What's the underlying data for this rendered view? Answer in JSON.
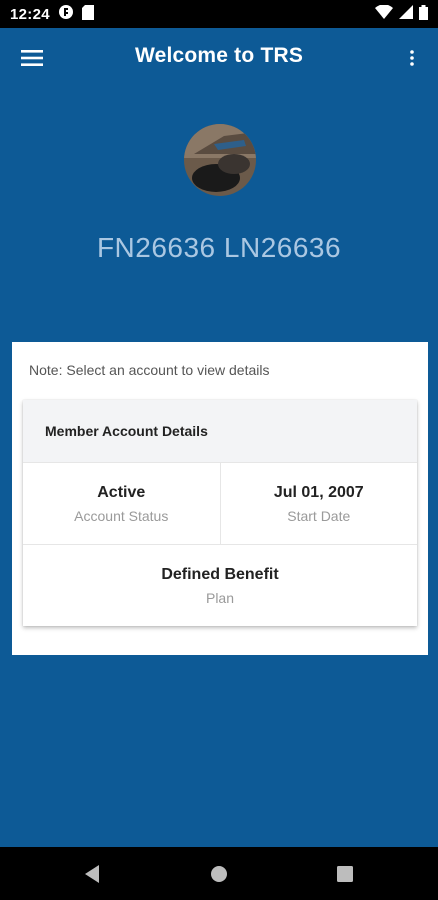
{
  "status_bar": {
    "time": "12:24",
    "icons_left": [
      "app-notification-icon",
      "sd-card-icon"
    ],
    "icons_right": [
      "wifi-icon",
      "signal-icon",
      "battery-icon"
    ]
  },
  "app_bar": {
    "title": "Welcome to TRS",
    "menu_icon": "hamburger-menu-icon",
    "overflow_icon": "more-vertical-icon"
  },
  "profile": {
    "name": "FN26636 LN26636"
  },
  "accounts": {
    "note": "Note: Select an account to view details",
    "card_title": "Member Account Details",
    "fields": [
      {
        "value": "Active",
        "label": "Account Status"
      },
      {
        "value": "Jul 01, 2007",
        "label": "Start Date"
      },
      {
        "value": "Defined Benefit",
        "label": "Plan"
      }
    ]
  },
  "nav_bar": {
    "buttons": [
      "back-icon",
      "home-icon",
      "recents-icon"
    ]
  },
  "colors": {
    "primary": "#0d5a96",
    "name_text": "#aac7e2",
    "card_header_bg": "#f3f4f6"
  }
}
